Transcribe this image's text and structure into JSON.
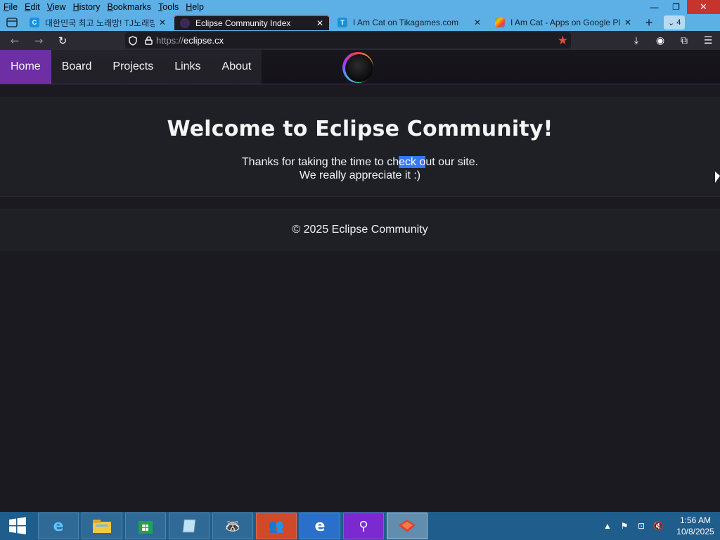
{
  "menubar": {
    "items": [
      "File",
      "Edit",
      "View",
      "History",
      "Bookmarks",
      "Tools",
      "Help"
    ],
    "underline_letters": [
      "F",
      "E",
      "V",
      "H",
      "B",
      "T",
      "H"
    ]
  },
  "tabs": [
    {
      "title": "대한민국 최고 노래방! TJ노래방",
      "favicon": "c-icon",
      "favicon_color": "#1a8fe0"
    },
    {
      "title": "Eclipse Community Index",
      "favicon": "eclipse-icon",
      "favicon_color": "#3a2a55"
    },
    {
      "title": "I Am Cat on Tikagames.com",
      "favicon": "tikagames-icon",
      "favicon_color": "#1c8fd6"
    },
    {
      "title": "I Am Cat - Apps on Google Play",
      "favicon": "google-play-icon",
      "favicon_color": "#34a853"
    }
  ],
  "tab_count": "4",
  "url": {
    "scheme": "https://",
    "host": "eclipse.cx"
  },
  "site": {
    "nav": [
      "Home",
      "Board",
      "Projects",
      "Links",
      "About"
    ],
    "active_nav": "Home",
    "heading": "Welcome to Eclipse Community!",
    "line1_pre": "Thanks for taking the time to ch",
    "line1_sel": "eck o",
    "line1_post": "ut our site.",
    "line2": "We really appreciate it :)",
    "footer": "© 2025 Eclipse Community",
    "accent": "#6d2fa3"
  },
  "taskbar": {
    "apps": [
      "internet-explorer-icon",
      "file-explorer-icon",
      "store-icon",
      "notepad-icon",
      "raccoon-icon",
      "people-icon",
      "edge-icon",
      "search-icon",
      "firefox-icon"
    ],
    "time": "1:56 AM",
    "date": "10/8/2025"
  }
}
